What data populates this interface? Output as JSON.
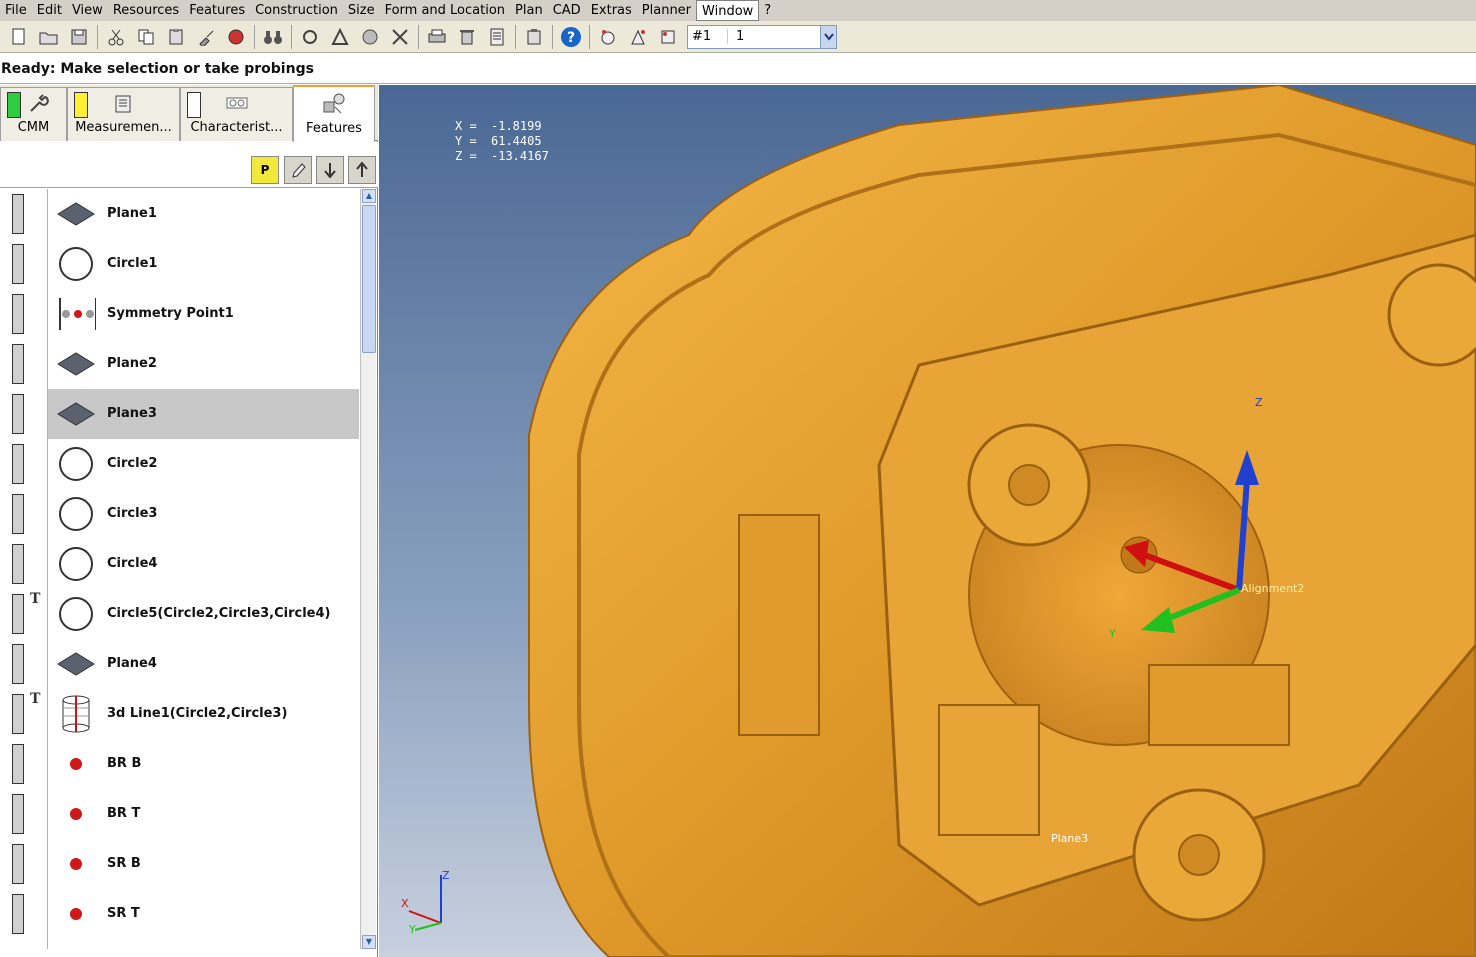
{
  "menu": [
    "File",
    "Edit",
    "View",
    "Resources",
    "Features",
    "Construction",
    "Size",
    "Form and Location",
    "Plan",
    "CAD",
    "Extras",
    "Planner",
    "Window",
    "?"
  ],
  "toolbar": {
    "select_hash": "#1",
    "select_value": "1"
  },
  "status": "Ready: Make selection or take probings",
  "tabs": [
    {
      "label": "CMM",
      "swatch": "#2ecc40"
    },
    {
      "label": "Measuremen...",
      "swatch": "#ffee33"
    },
    {
      "label": "Characterist...",
      "swatch": "#ffffff"
    },
    {
      "label": "Features",
      "swatch": null
    }
  ],
  "list_tools": {
    "p_label": "P"
  },
  "features": [
    {
      "label": "Plane1",
      "icon": "plane-icon",
      "t": false,
      "selected": false
    },
    {
      "label": "Circle1",
      "icon": "circle-icon",
      "t": false,
      "selected": false
    },
    {
      "label": "Symmetry Point1",
      "icon": "symmetry-point-icon",
      "t": false,
      "selected": false
    },
    {
      "label": "Plane2",
      "icon": "plane-icon",
      "t": false,
      "selected": false
    },
    {
      "label": "Plane3",
      "icon": "plane-icon",
      "t": false,
      "selected": true
    },
    {
      "label": "Circle2",
      "icon": "circle-icon",
      "t": false,
      "selected": false
    },
    {
      "label": "Circle3",
      "icon": "circle-icon",
      "t": false,
      "selected": false
    },
    {
      "label": "Circle4",
      "icon": "circle-icon",
      "t": false,
      "selected": false
    },
    {
      "label": "Circle5(Circle2,Circle3,Circle4)",
      "icon": "circle-icon",
      "t": true,
      "selected": false
    },
    {
      "label": "Plane4",
      "icon": "plane-icon",
      "t": false,
      "selected": false
    },
    {
      "label": "3d Line1(Circle2,Circle3)",
      "icon": "cylinder-icon",
      "t": true,
      "selected": false
    },
    {
      "label": "BR B",
      "icon": "point-icon",
      "t": false,
      "selected": false
    },
    {
      "label": "BR T",
      "icon": "point-icon",
      "t": false,
      "selected": false
    },
    {
      "label": "SR B",
      "icon": "point-icon",
      "t": false,
      "selected": false
    },
    {
      "label": "SR T",
      "icon": "point-icon",
      "t": false,
      "selected": false
    }
  ],
  "t_marker": "T",
  "viewport": {
    "coords": [
      {
        "k": "X =",
        "v": "-1.8199"
      },
      {
        "k": "Y =",
        "v": "61.4405"
      },
      {
        "k": "Z =",
        "v": "-13.4167"
      }
    ],
    "alignment_label": "Alignment2",
    "plane_label": "Plane3",
    "axis_x": "X",
    "axis_y": "Y",
    "axis_z": "Z",
    "part_color": "#e8a030"
  }
}
